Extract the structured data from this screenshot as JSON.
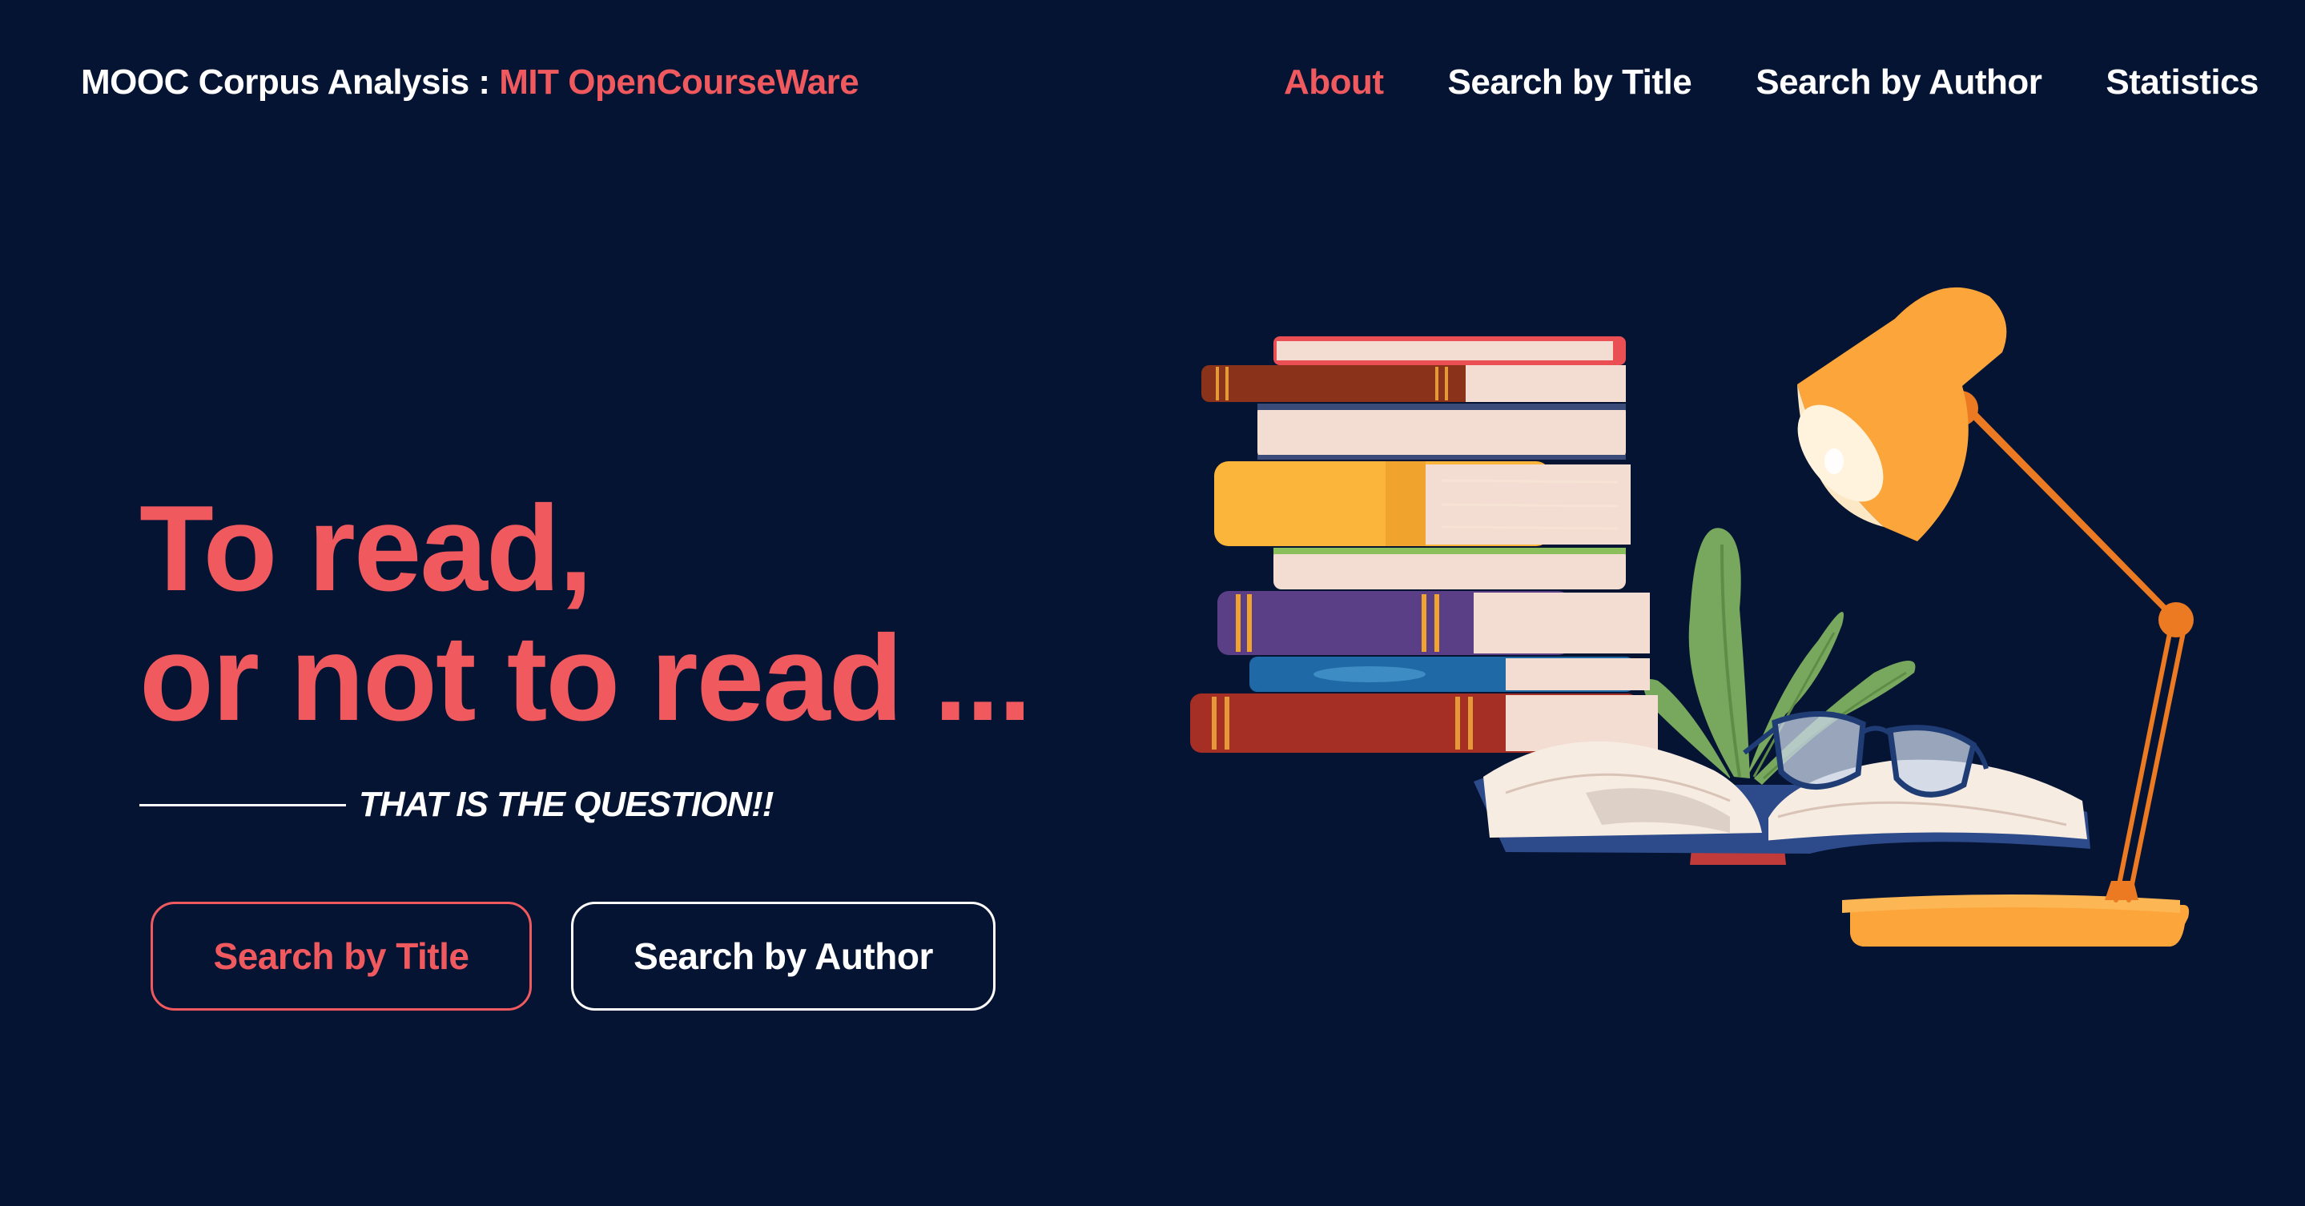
{
  "header": {
    "brand_prefix": "MOOC Corpus Analysis : ",
    "brand_accent": "MIT OpenCourseWare"
  },
  "nav": {
    "items": [
      {
        "label": "About",
        "active": true
      },
      {
        "label": "Search by Title",
        "active": false
      },
      {
        "label": "Search by Author",
        "active": false
      },
      {
        "label": "Statistics",
        "active": false
      }
    ]
  },
  "hero": {
    "title_line1": "To read,",
    "title_line2": "or not to read ...",
    "tagline": "THAT IS THE QUESTION!!"
  },
  "buttons": {
    "search_title": "Search by Title",
    "search_author": "Search by Author"
  },
  "illustration": {
    "icons": [
      "book-stack-icon",
      "plant-icon",
      "desk-lamp-icon",
      "open-book-icon",
      "glasses-icon"
    ]
  },
  "colors": {
    "background": "#061434",
    "accent": "#f05a5f",
    "text": "#ffffff",
    "lamp": "#fca53a",
    "lamp_arm": "#ec7a22"
  }
}
